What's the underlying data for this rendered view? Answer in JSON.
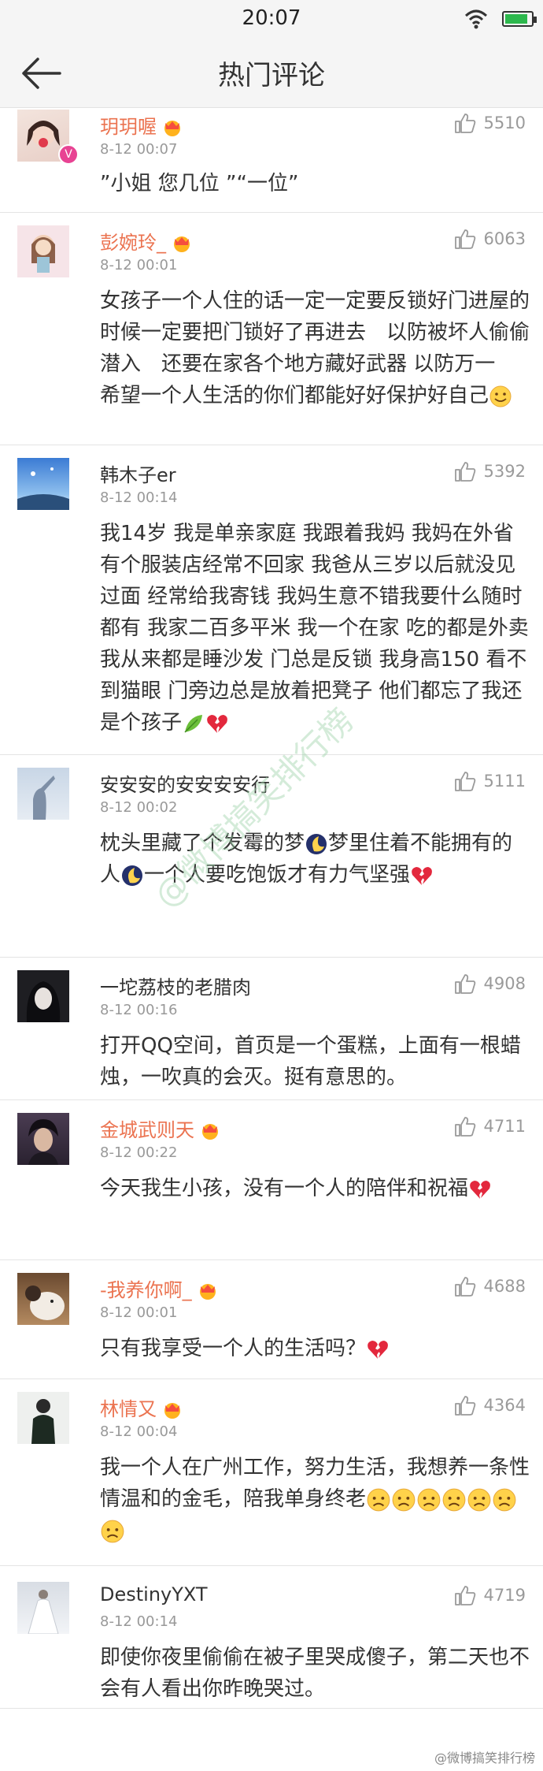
{
  "status": {
    "time": "20:07"
  },
  "header": {
    "title": "热门评论"
  },
  "comments": [
    {
      "name": "玥玥喔",
      "vip": true,
      "verified": true,
      "time": "8-12 00:07",
      "likes": "5510",
      "text": "”小姐 您几位 ”“一位”"
    },
    {
      "name": "彭婉玲_",
      "vip": true,
      "verified": false,
      "time": "8-12 00:01",
      "likes": "6063",
      "text": "女孩子一个人住的话一定一定要反锁好门进屋的时候一定要把门锁好了再进去　以防被坏人偷偷潜入　还要在家各个地方藏好武器 以防万一　希望一个人生活的你们都能好好保护好自己"
    },
    {
      "name": "韩木子er",
      "vip": false,
      "verified": false,
      "time": "8-12 00:14",
      "likes": "5392",
      "text": "我14岁 我是单亲家庭 我跟着我妈 我妈在外省有个服装店经常不回家 我爸从三岁以后就没见过面 经常给我寄钱 我妈生意不错我要什么随时都有 我家二百多平米 我一个在家 吃的都是外卖 我从来都是睡沙发 门总是反锁 我身高150 看不到猫眼 门旁边总是放着把凳子 他们都忘了我还是个孩子"
    },
    {
      "name": "安安安的安安安安行",
      "vip": false,
      "verified": false,
      "time": "8-12 00:02",
      "likes": "5111",
      "text": "枕头里藏了个发霉的梦"
    },
    {
      "name": "一坨荔枝的老腊肉",
      "vip": false,
      "verified": false,
      "time": "8-12 00:16",
      "likes": "4908",
      "text": "打开QQ空间，首页是一个蛋糕，上面有一根蜡烛，一吹真的会灭。挺有意思的。"
    },
    {
      "name": "金城武则天",
      "vip": true,
      "verified": false,
      "time": "8-12 00:22",
      "likes": "4711",
      "text": "今天我生小孩，没有一个人的陪伴和祝福"
    },
    {
      "name": "-我养你啊_",
      "vip": true,
      "verified": false,
      "time": "8-12 00:01",
      "likes": "4688",
      "text": "只有我享受一个人的生活吗？"
    },
    {
      "name": "林情又",
      "vip": true,
      "verified": false,
      "time": "8-12 00:04",
      "likes": "4364",
      "text": "我一个人在广州工作，努力生活，我想养一条性情温和的金毛，陪我单身终老"
    },
    {
      "name": "DestinyYXT",
      "vip": false,
      "verified": false,
      "time": "8-12 00:14",
      "likes": "4719",
      "text": "即使你夜里偷偷在被子里哭成傻子，第二天也不会有人看出你昨晚哭过。"
    }
  ],
  "extra_text": {
    "c4_part2": "梦里住着不能拥有的人",
    "c4_part3": "一个人要吃饱饭才有力气坚强"
  },
  "watermark": "@微博搞笑排行榜",
  "colors": {
    "name_orange": "#eb7350",
    "like_gray": "#9a9a9a",
    "divider": "#e4e4e4"
  }
}
